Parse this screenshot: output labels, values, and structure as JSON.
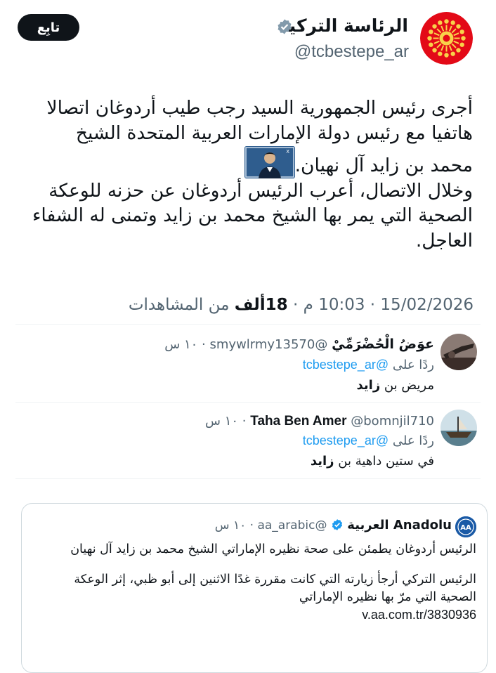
{
  "author": {
    "name": "الرئاسة التركية",
    "handle": "@tcbestepe_ar",
    "verified": true,
    "follow_label": "تابِع"
  },
  "tweet": {
    "lines": [
      "أجرى رئيس الجمهورية السيد رجب طيب أردوغان اتصالا",
      "هاتفيا مع رئيس دولة الإمارات العربية المتحدة الشيخ",
      "محمد بن زايد آل نهيان.",
      "وخلال الاتصال، أعرب الرئيس أردوغان عن حزنه للوعكة",
      "الصحية التي يمر بها الشيخ محمد بن زايد وتمنى له الشفاء",
      "العاجل."
    ]
  },
  "meta": {
    "time": "10:03 م",
    "date": "15/02/2026",
    "views_count": "18ألف",
    "views_label": "من المشاهدات",
    "separator": "·"
  },
  "replies": [
    {
      "name": "عوَضُ الْحُضْرَمِّيْ",
      "handle": "@smywlrmy13570",
      "time": "١٠ س",
      "replying_label": "ردًا على",
      "replying_to": "@tcbestepe_ar",
      "text_plain": "مريض بن ",
      "text_bold": "زايد"
    },
    {
      "name": "Taha Ben Amer",
      "handle": "@bomnjil710",
      "time": "١٠ س",
      "replying_label": "ردًا على",
      "replying_to": "@tcbestepe_ar",
      "text_plain": "في ستين داهية بن ",
      "text_bold": "زايد"
    }
  ],
  "quote": {
    "name": "Anadolu العربية",
    "handle": "@aa_arabic",
    "time": "١٠ س",
    "line1": "الرئيس أردوغان يطمئن على صحة نظيره الإماراتي الشيخ محمد بن زايد آل نهيان",
    "line2": "الرئيس التركي أرجأ زيارته التي كانت مقررة غدًا الاثنين إلى أبو ظبي، إثر الوعكة",
    "line3": "الصحية التي مرّ بها نظيره الإماراتي",
    "link": "v.aa.com.tr/3830936",
    "avatar_text": "AA"
  },
  "colors": {
    "accent": "#1d9bf0",
    "secondary_text": "#536471",
    "primary_text": "#0f1419",
    "seal_red": "#e30a17"
  },
  "icons": {
    "verified": "verified-badge-icon",
    "seal": "presidential-seal-icon"
  }
}
